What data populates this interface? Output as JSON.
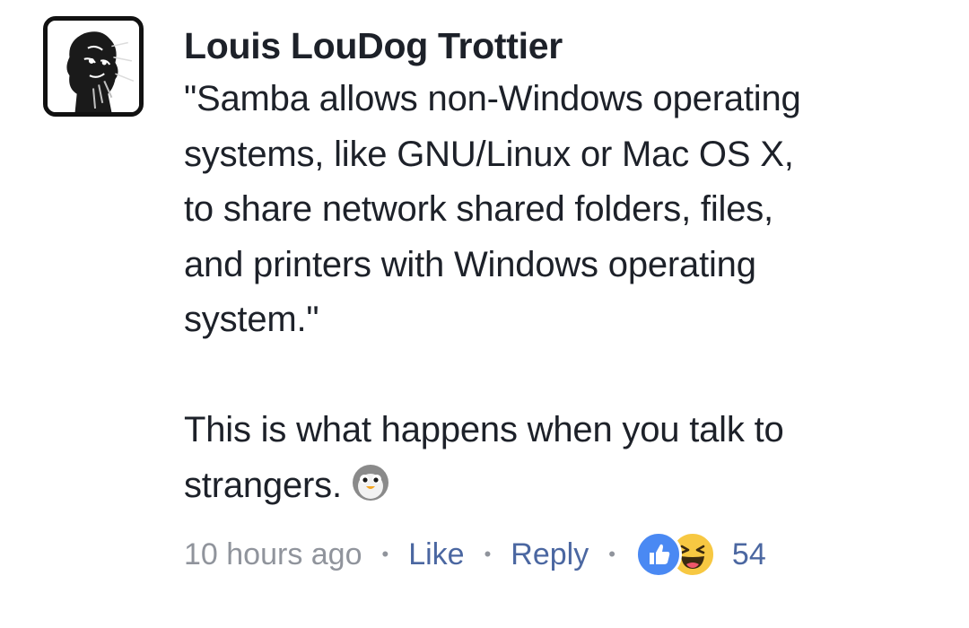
{
  "comment": {
    "author": "Louis LouDog Trottier",
    "text": "\"Samba allows non-Windows operating\nsystems, like GNU/Linux or Mac OS X,\nto share network shared folders, files,\nand printers with Windows operating\nsystem.\"\n\nThis is what happens when you talk to\nstrangers.",
    "emoji": "penguin-icon",
    "timestamp": "10 hours ago",
    "like_label": "Like",
    "reply_label": "Reply",
    "separator": "•",
    "reaction_count": "54",
    "reactions": [
      "like-icon",
      "haha-icon"
    ]
  },
  "colors": {
    "text": "#1d2129",
    "meta": "#90949c",
    "link": "#4b67a1",
    "like_reaction": "#4a89f3",
    "haha_reaction": "#f7c842"
  }
}
